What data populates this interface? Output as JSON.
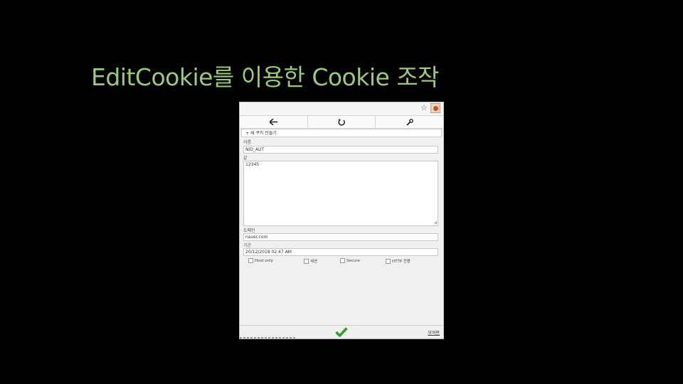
{
  "slide": {
    "title": "EditCookie를 이용한 Cookie 조작"
  },
  "browser": {
    "star_icon": "☆",
    "extension_icon": "cookie-icon"
  },
  "toolbar": {
    "back": "🡐",
    "reset": "↻",
    "settings": "🔧"
  },
  "panel": {
    "title": "+ 새 쿠키 만들기"
  },
  "form": {
    "name_label": "이름",
    "name_value": "NID_AUT",
    "value_label": "값",
    "value_value": "12345",
    "domain_label": "도메인",
    "domain_value": "naver.com",
    "expires_label": "기간",
    "expires_value": "20/12/2018 02:47 AM",
    "flags": [
      "Host only",
      "세션",
      "Secure",
      "HTTP 전용"
    ]
  },
  "footer": {
    "save_label": "모여판"
  },
  "colors": {
    "title": "#9bc97a",
    "check": "#2e9e2e",
    "background": "#000000"
  }
}
